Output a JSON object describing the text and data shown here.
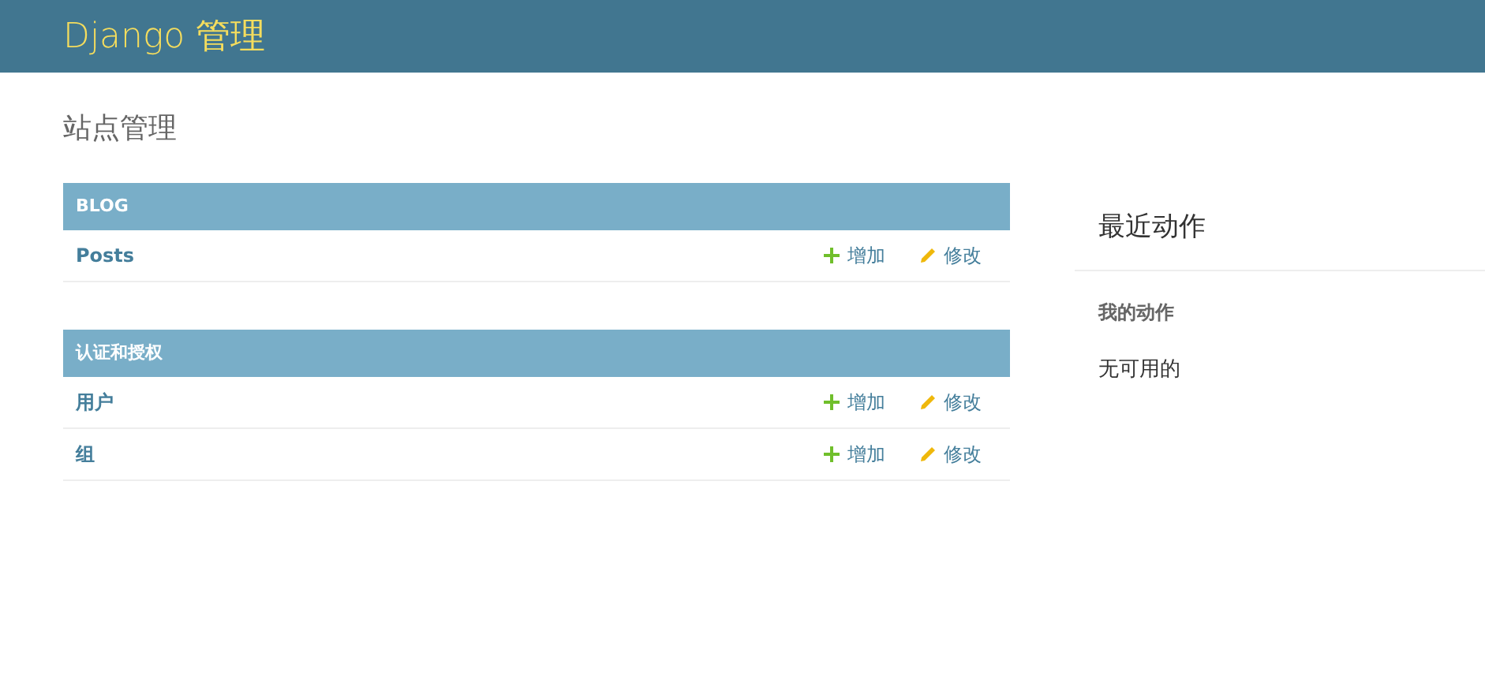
{
  "header": {
    "title": "Django 管理"
  },
  "page_title": "站点管理",
  "modules": [
    {
      "caption": "BLOG",
      "rows": [
        {
          "name": "Posts",
          "add": "增加",
          "change": "修改"
        }
      ]
    },
    {
      "caption": "认证和授权",
      "rows": [
        {
          "name": "用户",
          "add": "增加",
          "change": "修改"
        },
        {
          "name": "组",
          "add": "增加",
          "change": "修改"
        }
      ]
    }
  ],
  "recent_actions": {
    "title": "最近动作",
    "subtitle": "我的动作",
    "empty": "无可用的"
  }
}
